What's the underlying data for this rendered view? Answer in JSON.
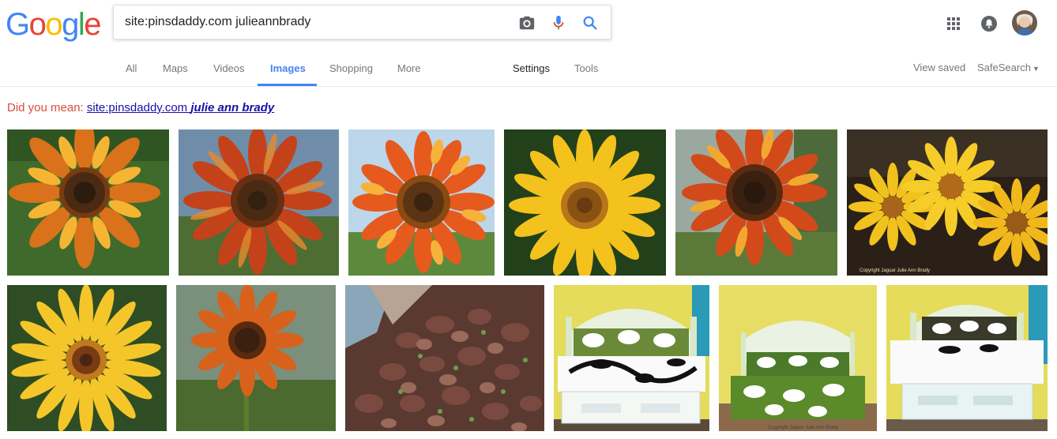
{
  "header": {
    "logo_letters": [
      "G",
      "o",
      "o",
      "g",
      "l",
      "e"
    ],
    "logo_colors": [
      "#4285f4",
      "#ea4335",
      "#fbbc05",
      "#4285f4",
      "#34a853",
      "#ea4335"
    ],
    "search_value": "site:pinsdaddy.com julieannbrady",
    "icons": [
      "camera-icon",
      "microphone-icon",
      "search-icon",
      "apps-grid-icon",
      "notifications-icon",
      "avatar"
    ]
  },
  "tabs": {
    "all": "All",
    "maps": "Maps",
    "videos": "Videos",
    "images": "Images",
    "shopping": "Shopping",
    "more": "More",
    "settings": "Settings",
    "tools": "Tools",
    "view_saved": "View saved",
    "safesearch": "SafeSearch",
    "active_color": "#4285f4"
  },
  "did_you_mean": {
    "prefix": "Did you mean: ",
    "link_plain": "site:pinsdaddy.com ",
    "link_bold": "julie ann brady"
  },
  "images": {
    "row1": [
      "sunflower-red-orange",
      "sunflower-red-orange",
      "sunflower-orange-sky",
      "sunflower-yellow",
      "sunflower-red-orange",
      "yellow-daisies-trio"
    ],
    "row2": [
      "yellow-gerbera",
      "orange-sunflower",
      "red-lava-rocks",
      "daybed-green-white",
      "daybed-green-white",
      "daybed-green-white"
    ],
    "watermark_daisies": "Copyright Jaguar Julie Ann Brady",
    "watermark_bed": "Copyright Jaguar Julie Ann Brady"
  }
}
